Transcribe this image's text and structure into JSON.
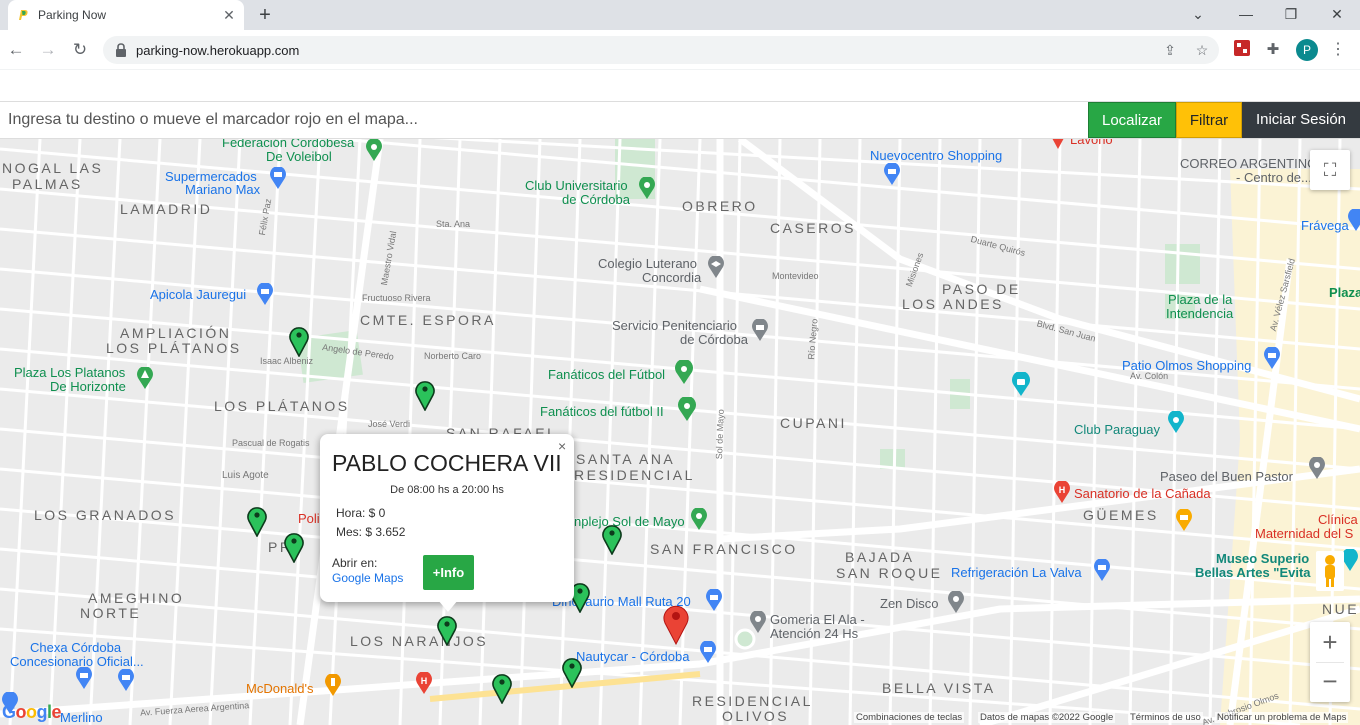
{
  "browser": {
    "tab_title": "Parking Now",
    "tab_close": "✕",
    "new_tab": "+",
    "url": "parking-now.herokuapp.com",
    "profile_initial": "P",
    "controls": {
      "minimize": "⌄",
      "restore": "—",
      "maximize": "❐",
      "close": "✕"
    }
  },
  "header": {
    "search_placeholder": "Ingresa tu destino o mueve el marcador rojo en el mapa...",
    "locate_label": "Localizar",
    "filter_label": "Filtrar",
    "login_label": "Iniciar Sesión",
    "colors": {
      "locate": "#28a745",
      "filter": "#ffc107",
      "login": "#343a40"
    }
  },
  "map": {
    "neighborhoods": [
      "NOGAL LAS",
      "PALMAS",
      "LAMADRID",
      "OBRERO",
      "CASEROS",
      "PASO DE",
      "LOS ANDES",
      "AMPLIACIÓN",
      "LOS PLÁTANOS",
      "CMTE. ESPORA",
      "LOS PLÁTANOS",
      "CUPANI",
      "SAN RAFAEL",
      "SANTA ANA",
      "RESIDENCIAL",
      "LOS GRANADOS",
      "SAN FRANCISCO",
      "BAJADA",
      "SAN ROQUE",
      "GÜEMES",
      "AMEGHINO",
      "NORTE",
      "LOS NARANJOS",
      "BELLA VISTA",
      "RESIDENCIAL",
      "OLIVOS",
      "NUE"
    ],
    "places": {
      "federacion": "Federación Cordobesa",
      "voleibol": "De Voleibol",
      "nuevocentro": "Nuevocentro Shopping",
      "correo1": "CORREO ARGENTINO",
      "correo2": "- Centro de...",
      "supermercados": "Supermercados",
      "mariano": "Mariano Max",
      "club_uni": "Club Universitario",
      "de_cordoba": "de Córdoba",
      "fravega": "Frávega",
      "colegio": "Colegio Luterano",
      "concordia": "Concordia",
      "apicola": "Apicola Jauregui",
      "plaza_int1": "Plaza de la",
      "plaza_int2": "Intendencia",
      "plaza_cut": "Plaza",
      "servicio1": "Servicio Penitenciario",
      "servicio2": "de Córdoba",
      "plaza_plat1": "Plaza Los Platanos",
      "plaza_plat2": "De Horizonte",
      "fanaticos1": "Fanáticos del Fútbol",
      "fanaticos2": "Fanáticos del fútbol II",
      "patio": "Patio Olmos Shopping",
      "club_paraguay": "Club Paraguay",
      "paseo": "Paseo del Buen Pastor",
      "sanatorio": "Sanatorio de la Cañada",
      "clinica1": "Clínica",
      "clinica2": "Maternidad del S",
      "complejo": "nplejo Sol de Mayo",
      "museo1": "Museo Superio",
      "museo2": "Bellas Artes \"Evita",
      "refrigeracion": "Refrigeración La Valva",
      "dinosaurio": "Dinosaurio Mall Ruta 20",
      "zen": "Zen Disco",
      "gomeria1": "Gomeria El Ala -",
      "gomeria2": "Atención 24 Hs",
      "nautycar": "Nautycar - Córdoba",
      "chexa1": "Chexa Córdoba",
      "chexa2": "Concesionario Oficial...",
      "mcdonalds": "McDonald's",
      "merlino": "Merlino",
      "poli": "Poli",
      "pr": "PR",
      "lavono": "Lavono"
    },
    "streets": [
      "Félix Paz",
      "Maestro Vidal",
      "Angelo de Peredo",
      "Sta. Ana",
      "Av. Fuerza Aerea Argentina",
      "Blvd. San Juan",
      "Duarte Quirós",
      "Sol de Mayo",
      "Río Negro",
      "Misiones",
      "Av. Vélez Sarsfield",
      "Av. Ambrosio Olmos",
      "Luis Agote",
      "Norberto Caro",
      "José Verdi",
      "Pascual de Rogatis",
      "Isaac Albeniz",
      "Fructuoso Rivera",
      "Montevideo",
      "Av. Colón"
    ],
    "footer": {
      "shortcuts": "Combinaciones de teclas",
      "data": "Datos de mapas ©2022 Google",
      "terms": "Términos de uso",
      "report": "Notificar un problema de Maps"
    },
    "google_logo": "Google"
  },
  "info_window": {
    "name": "PABLO COCHERA VII",
    "hours": "De 08:00 hs a 20:00 hs",
    "hour_price": "Hora: $ 0",
    "month_price": "Mes: $ 3.652",
    "open_in": "Abrir en:",
    "google_maps": "Google Maps",
    "more_info": "+Info",
    "close": "×"
  }
}
